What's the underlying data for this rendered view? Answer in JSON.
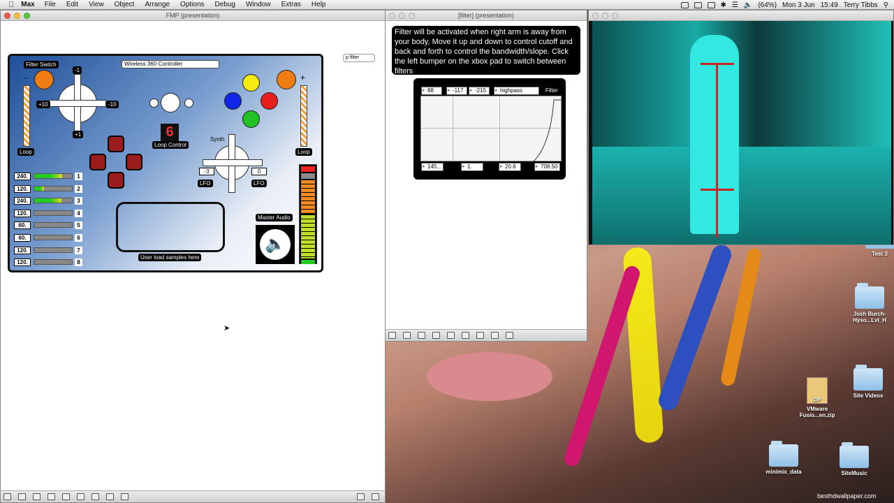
{
  "menubar": {
    "app": "Max",
    "items": [
      "File",
      "Edit",
      "View",
      "Object",
      "Arrange",
      "Options",
      "Debug",
      "Window",
      "Extras",
      "Help"
    ],
    "battery": "(64%)",
    "date": "Mon 3 Jun",
    "time": "15:49",
    "user": "Terry Tibbs"
  },
  "main_window": {
    "title": "FMP (presentation)",
    "p_object": "p filter",
    "controller_select": "Wireless 360 Controller",
    "filter_switch": "Filter Switch",
    "loop": "Loop",
    "loop_control": "Loop Control",
    "loop_digit": "6",
    "synth": "Synth",
    "master_audio": "Master Audio",
    "samples": "User load samples here",
    "lfo": "LFO",
    "minus": "-",
    "plus": "+",
    "dpad_left": {
      "top": "-1",
      "left": "+10",
      "right": "-10",
      "bottom": "+1"
    },
    "synth_left": "-3",
    "synth_right": "0",
    "tracks": [
      {
        "bpm": "240.",
        "n": "1",
        "level": 0.74
      },
      {
        "bpm": "120.",
        "n": "2",
        "level": 0.25
      },
      {
        "bpm": "240.",
        "n": "3",
        "level": 0.72
      },
      {
        "bpm": "120.",
        "n": "4",
        "level": 0
      },
      {
        "bpm": "60.",
        "n": "5",
        "level": 0
      },
      {
        "bpm": "60.",
        "n": "6",
        "level": 0
      },
      {
        "bpm": "120.",
        "n": "7",
        "level": 0
      },
      {
        "bpm": "120.",
        "n": "8",
        "level": 0
      }
    ]
  },
  "filter_window": {
    "title": "[filter] (presentation)",
    "note": "Filter will be activated when right arm is away from your body, Move it up and down to control cutoff and back and forth to control the bandwidth/slope. Click the left bumper on the xbox pad to switch between filters",
    "top_values": [
      "88",
      "-117",
      "-215"
    ],
    "mode": "highpass",
    "filter_label": "Filter",
    "bottom_values": [
      "145...",
      "1.",
      "20.6",
      "708.50"
    ]
  },
  "desktop": {
    "icons": [
      "Test 3",
      "Josh Burch-\nHyso...Lvl_H",
      "Site Videos",
      "VMware\nFusio...en.zip",
      "minimix_data",
      "SiteMusic"
    ],
    "zip_label": "ZIP",
    "watermark": "besthdwallpaper.com"
  }
}
